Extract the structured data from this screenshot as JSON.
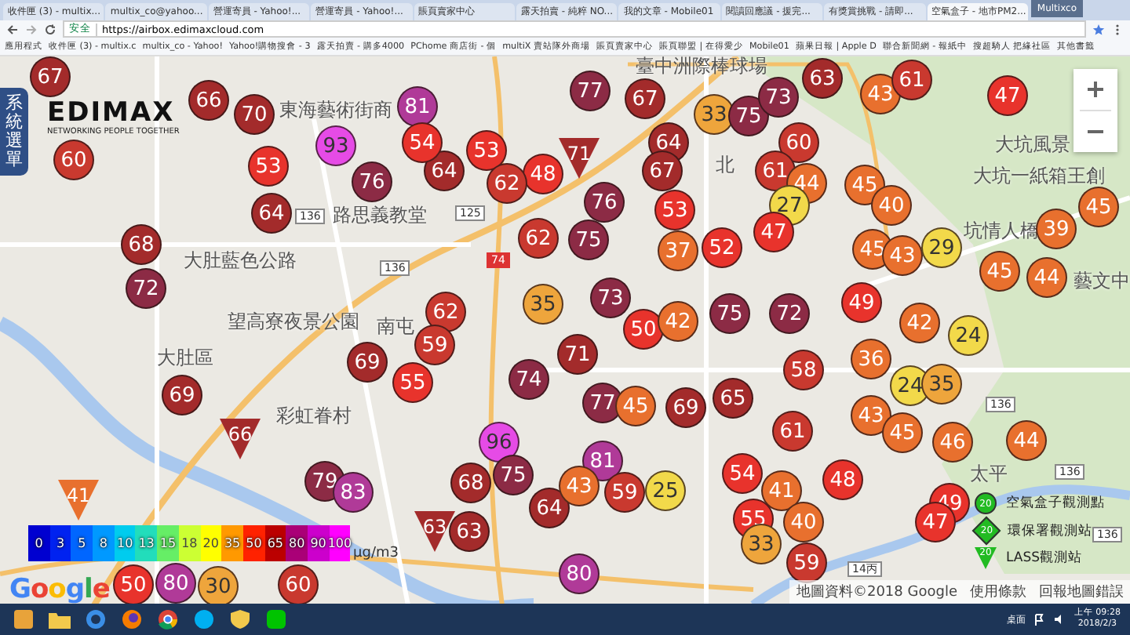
{
  "browser": {
    "tabs": [
      {
        "label": "收件匣 (3) - multix...",
        "selected": false
      },
      {
        "label": "multix_co@yahoo...",
        "selected": false
      },
      {
        "label": "營運寄員 - Yahoo!...",
        "selected": false
      },
      {
        "label": "營運寄員 - Yahoo!...",
        "selected": false
      },
      {
        "label": "賬頁賣家中心",
        "selected": false
      },
      {
        "label": "露天拍賣 - 純粹 NO...",
        "selected": false
      },
      {
        "label": "我的文章 - Mobile01",
        "selected": false
      },
      {
        "label": "閱讀回應議 - 援完...",
        "selected": false
      },
      {
        "label": "有獎賞挑戰 - 請即...",
        "selected": false
      },
      {
        "label": "空氣盒子 - 地市PM2...",
        "selected": true
      }
    ],
    "user": "Multixco",
    "address": {
      "secure_label": "安全",
      "url": "https://airbox.edimaxcloud.com"
    },
    "bookmarks": [
      "應用程式",
      "收件匣 (3) - multix.c",
      "multix_co - Yahoo!",
      "Yahoo!購物搜會 - 3",
      "露天拍賣 - 購多4000",
      "PChome 商店街 - 個",
      "multiX 賣站隊外商場",
      "賬頁賣家中心",
      "賬頁聯盟 | 在得愛少",
      "Mobile01",
      "蘋果日報 | Apple D",
      "聯合新聞網 - 報紙中",
      "搜超騎人 把緣社區",
      "其他書籤"
    ]
  },
  "side_menu": "系統選單",
  "logo": {
    "name": "EDIMAX",
    "tagline": "NETWORKING PEOPLE TOGETHER"
  },
  "map": {
    "labels": [
      {
        "kind": "place",
        "text": "東海藝術街商"
      },
      {
        "kind": "place",
        "text": "路思義教堂"
      },
      {
        "kind": "place",
        "text": "大肚藍色公路"
      },
      {
        "kind": "place",
        "text": "望高寮夜景公園"
      },
      {
        "kind": "place",
        "text": "大肚區"
      },
      {
        "kind": "place",
        "text": "南屯"
      },
      {
        "kind": "place",
        "text": "彩虹眷村"
      },
      {
        "kind": "place",
        "text": "臺中洲際棒球場"
      },
      {
        "kind": "place",
        "text": "北"
      },
      {
        "kind": "place",
        "text": "大坑風景"
      },
      {
        "kind": "place",
        "text": "大坑一紙箱王創"
      },
      {
        "kind": "place",
        "text": "坑情人橋"
      },
      {
        "kind": "place",
        "text": "藝文中"
      },
      {
        "kind": "place",
        "text": "太平"
      },
      {
        "kind": "shield",
        "text": "136"
      },
      {
        "kind": "shield",
        "text": "136"
      },
      {
        "kind": "shield",
        "text": "125"
      },
      {
        "kind": "shield",
        "text": "74"
      },
      {
        "kind": "shield",
        "text": "136"
      },
      {
        "kind": "shield",
        "text": "136"
      },
      {
        "kind": "shield",
        "text": "14丙"
      },
      {
        "kind": "shield",
        "text": "136"
      }
    ],
    "markers": [
      {
        "kind": "circle",
        "value": "67"
      },
      {
        "kind": "circle",
        "value": "66"
      },
      {
        "kind": "circle",
        "value": "70"
      },
      {
        "kind": "circle",
        "value": "60"
      },
      {
        "kind": "circle",
        "value": "53"
      },
      {
        "kind": "circle",
        "value": "64"
      },
      {
        "kind": "circle",
        "value": "76"
      },
      {
        "kind": "circle",
        "value": "93"
      },
      {
        "kind": "circle",
        "value": "64"
      },
      {
        "kind": "circle",
        "value": "53"
      },
      {
        "kind": "circle",
        "value": "81"
      },
      {
        "kind": "circle",
        "value": "54"
      },
      {
        "kind": "circle",
        "value": "77"
      },
      {
        "kind": "circle",
        "value": "67"
      },
      {
        "kind": "circle",
        "value": "33"
      },
      {
        "kind": "circle",
        "value": "75"
      },
      {
        "kind": "circle",
        "value": "73"
      },
      {
        "kind": "circle",
        "value": "63"
      },
      {
        "kind": "circle",
        "value": "43"
      },
      {
        "kind": "circle",
        "value": "61"
      },
      {
        "kind": "circle",
        "value": "47"
      },
      {
        "kind": "circle",
        "value": "48"
      },
      {
        "kind": "triangle",
        "value": "71"
      },
      {
        "kind": "circle",
        "value": "64"
      },
      {
        "kind": "circle",
        "value": "60"
      },
      {
        "kind": "circle",
        "value": "62"
      },
      {
        "kind": "circle",
        "value": "76"
      },
      {
        "kind": "circle",
        "value": "67"
      },
      {
        "kind": "circle",
        "value": "61"
      },
      {
        "kind": "circle",
        "value": "44"
      },
      {
        "kind": "circle",
        "value": "45"
      },
      {
        "kind": "circle",
        "value": "53"
      },
      {
        "kind": "circle",
        "value": "27"
      },
      {
        "kind": "circle",
        "value": "40"
      },
      {
        "kind": "circle",
        "value": "47"
      },
      {
        "kind": "circle",
        "value": "45"
      },
      {
        "kind": "circle",
        "value": "39"
      },
      {
        "kind": "circle",
        "value": "68"
      },
      {
        "kind": "circle",
        "value": "62"
      },
      {
        "kind": "circle",
        "value": "75"
      },
      {
        "kind": "circle",
        "value": "37"
      },
      {
        "kind": "circle",
        "value": "52"
      },
      {
        "kind": "circle",
        "value": "45"
      },
      {
        "kind": "circle",
        "value": "43"
      },
      {
        "kind": "circle",
        "value": "29"
      },
      {
        "kind": "circle",
        "value": "45"
      },
      {
        "kind": "circle",
        "value": "44"
      },
      {
        "kind": "circle",
        "value": "72"
      },
      {
        "kind": "circle",
        "value": "62"
      },
      {
        "kind": "circle",
        "value": "59"
      },
      {
        "kind": "circle",
        "value": "35"
      },
      {
        "kind": "circle",
        "value": "73"
      },
      {
        "kind": "circle",
        "value": "50"
      },
      {
        "kind": "circle",
        "value": "42"
      },
      {
        "kind": "circle",
        "value": "75"
      },
      {
        "kind": "circle",
        "value": "72"
      },
      {
        "kind": "circle",
        "value": "49"
      },
      {
        "kind": "circle",
        "value": "42"
      },
      {
        "kind": "circle",
        "value": "24"
      },
      {
        "kind": "circle",
        "value": "69"
      },
      {
        "kind": "circle",
        "value": "55"
      },
      {
        "kind": "circle",
        "value": "74"
      },
      {
        "kind": "circle",
        "value": "71"
      },
      {
        "kind": "circle",
        "value": "77"
      },
      {
        "kind": "circle",
        "value": "45"
      },
      {
        "kind": "circle",
        "value": "69"
      },
      {
        "kind": "circle",
        "value": "65"
      },
      {
        "kind": "circle",
        "value": "58"
      },
      {
        "kind": "circle",
        "value": "36"
      },
      {
        "kind": "circle",
        "value": "24"
      },
      {
        "kind": "circle",
        "value": "35"
      },
      {
        "kind": "circle",
        "value": "69"
      },
      {
        "kind": "triangle",
        "value": "66"
      },
      {
        "kind": "circle",
        "value": "96"
      },
      {
        "kind": "circle",
        "value": "61"
      },
      {
        "kind": "circle",
        "value": "43"
      },
      {
        "kind": "circle",
        "value": "45"
      },
      {
        "kind": "circle",
        "value": "46"
      },
      {
        "kind": "circle",
        "value": "44"
      },
      {
        "kind": "circle",
        "value": "79"
      },
      {
        "kind": "circle",
        "value": "83"
      },
      {
        "kind": "circle",
        "value": "68"
      },
      {
        "kind": "circle",
        "value": "75"
      },
      {
        "kind": "circle",
        "value": "81"
      },
      {
        "kind": "circle",
        "value": "54"
      },
      {
        "kind": "circle",
        "value": "48"
      },
      {
        "kind": "triangle",
        "value": "41"
      },
      {
        "kind": "circle",
        "value": "64"
      },
      {
        "kind": "circle",
        "value": "43"
      },
      {
        "kind": "circle",
        "value": "59"
      },
      {
        "kind": "circle",
        "value": "25"
      },
      {
        "kind": "circle",
        "value": "41"
      },
      {
        "kind": "circle",
        "value": "49"
      },
      {
        "kind": "triangle",
        "value": "63"
      },
      {
        "kind": "circle",
        "value": "63"
      },
      {
        "kind": "circle",
        "value": "55"
      },
      {
        "kind": "circle",
        "value": "40"
      },
      {
        "kind": "circle",
        "value": "47"
      },
      {
        "kind": "circle",
        "value": "33"
      },
      {
        "kind": "circle",
        "value": "50"
      },
      {
        "kind": "circle",
        "value": "80"
      },
      {
        "kind": "circle",
        "value": "30"
      },
      {
        "kind": "circle",
        "value": "60"
      },
      {
        "kind": "circle",
        "value": "80"
      },
      {
        "kind": "circle",
        "value": "59"
      }
    ],
    "scale": [
      {
        "label": "0",
        "color": "#0000d0"
      },
      {
        "label": "3",
        "color": "#0022f0"
      },
      {
        "label": "5",
        "color": "#0066ff"
      },
      {
        "label": "8",
        "color": "#0099ff"
      },
      {
        "label": "10",
        "color": "#00ccee"
      },
      {
        "label": "13",
        "color": "#22ddbb"
      },
      {
        "label": "15",
        "color": "#66ee66"
      },
      {
        "label": "18",
        "color": "#ccff33"
      },
      {
        "label": "20",
        "color": "#ffff00"
      },
      {
        "label": "35",
        "color": "#ff9900"
      },
      {
        "label": "50",
        "color": "#ff2200"
      },
      {
        "label": "65",
        "color": "#bb0000"
      },
      {
        "label": "80",
        "color": "#aa0077"
      },
      {
        "label": "90",
        "color": "#cc00cc"
      },
      {
        "label": "100",
        "color": "#ff00ff"
      }
    ],
    "unit": "μg/m3",
    "station_legend": [
      {
        "kind": "circle",
        "value": "20",
        "label": "空氣盒子觀測點"
      },
      {
        "kind": "diamond",
        "value": "20",
        "label": "環保署觀測站"
      },
      {
        "kind": "triangle",
        "value": "20",
        "label": "LASS觀測站"
      }
    ],
    "attribution": [
      "地圖資料©2018 Google",
      "使用條款",
      "回報地圖錯誤"
    ],
    "google": "Google"
  },
  "taskbar": {
    "tray_label": "桌面",
    "time": "上午 09:28",
    "date": "2018/2/3"
  }
}
